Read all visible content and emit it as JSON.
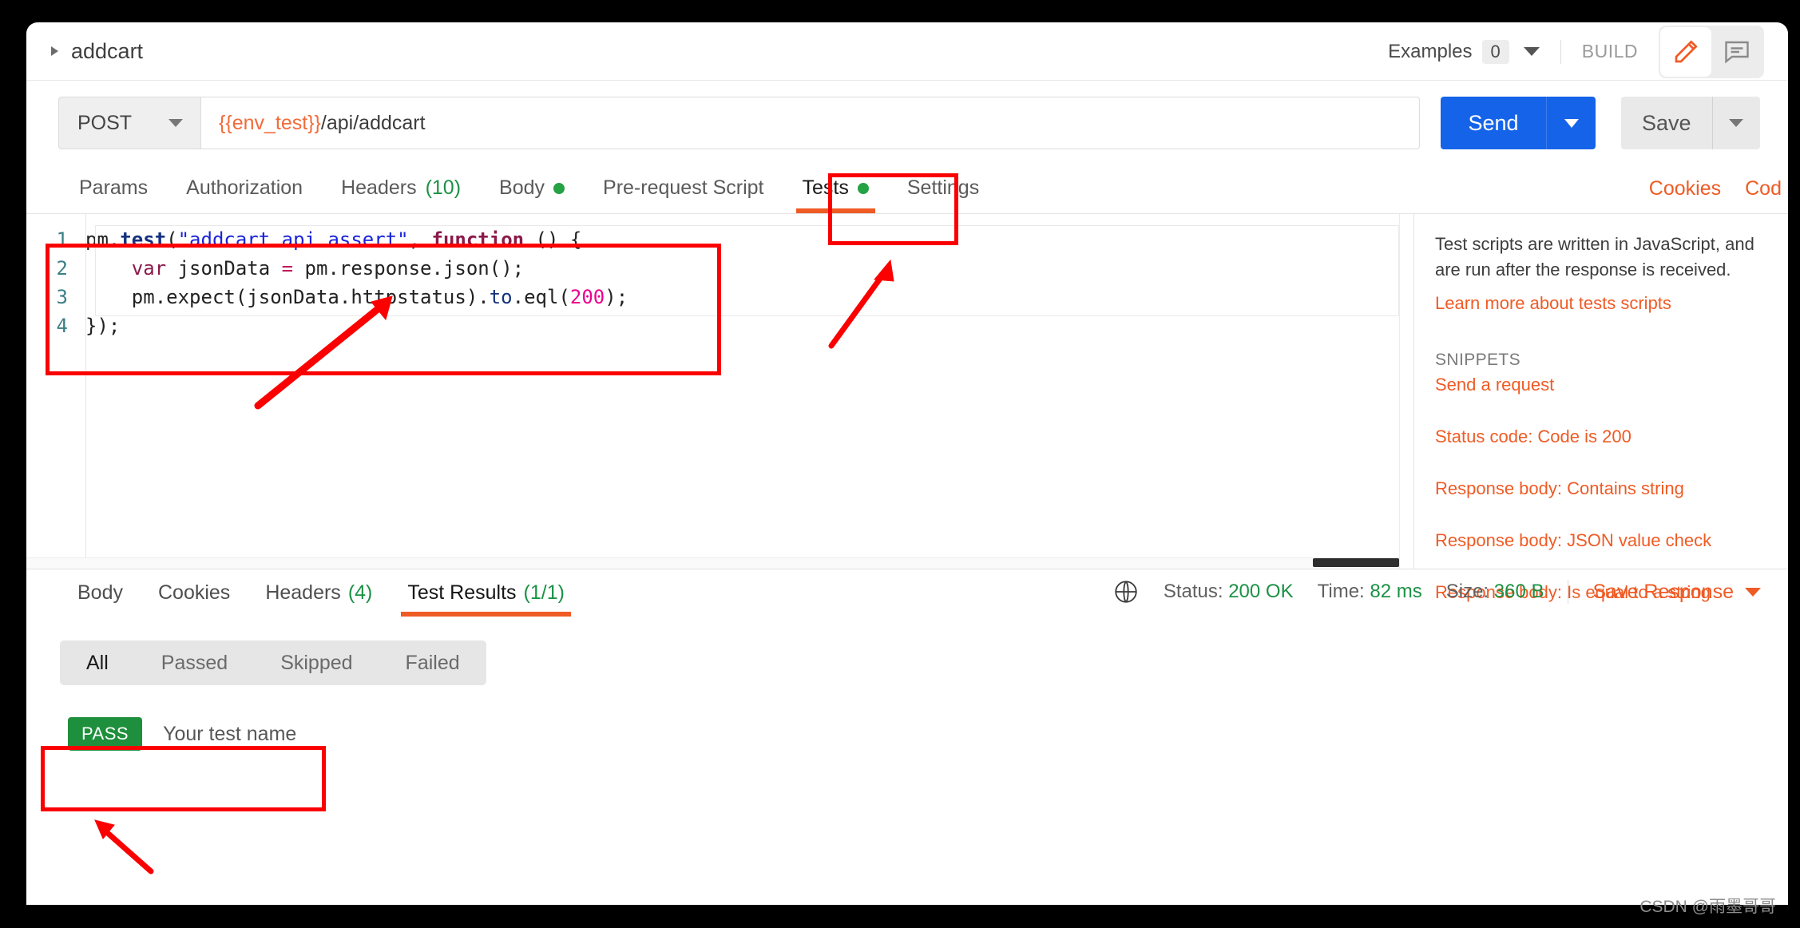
{
  "header": {
    "request_name": "addcart",
    "collapse_icon": "triangle-right-icon",
    "examples_label": "Examples",
    "examples_count": "0",
    "examples_caret": "chevron-down-icon",
    "build_label": "BUILD",
    "edit_icon": "pencil-icon",
    "comment_icon": "comment-icon"
  },
  "url_bar": {
    "method": "POST",
    "method_caret": "chevron-down-icon",
    "url_variable": "{{env_test}}",
    "url_path": "/api/addcart",
    "send_label": "Send",
    "send_caret": "chevron-down-icon",
    "save_label": "Save",
    "save_caret": "chevron-down-icon"
  },
  "request_tabs": [
    {
      "label": "Params",
      "count": "",
      "dot": false,
      "active": false
    },
    {
      "label": "Authorization",
      "count": "",
      "dot": false,
      "active": false
    },
    {
      "label": "Headers",
      "count": "(10)",
      "dot": false,
      "active": false
    },
    {
      "label": "Body",
      "count": "",
      "dot": true,
      "active": false
    },
    {
      "label": "Pre-request Script",
      "count": "",
      "dot": false,
      "active": false
    },
    {
      "label": "Tests",
      "count": "",
      "dot": true,
      "active": true
    },
    {
      "label": "Settings",
      "count": "",
      "dot": false,
      "active": false
    }
  ],
  "request_tab_links": [
    "Cookies",
    "Cod"
  ],
  "code": {
    "lines": [
      {
        "num": "1"
      },
      {
        "num": "2"
      },
      {
        "num": "3"
      },
      {
        "num": "4"
      }
    ],
    "line1_text": "pm.test(\"addcart api assert\", function () {",
    "line2_text": "    var jsonData = pm.response.json();",
    "line3_text": "    pm.expect(jsonData.httpstatus).to.eql(200);",
    "line4_text": "});",
    "t1_pm": "pm",
    "t1_dot": ".",
    "t1_test": "test",
    "t1_paren": "(",
    "t1_str": "\"addcart api assert\"",
    "t1_comma": ", ",
    "t1_function": "function",
    "t1_tail": " () {",
    "t2_indent": "    ",
    "t2_var": "var",
    "t2_name": " jsonData ",
    "t2_eq": "=",
    "t2_tail": " pm.response.json();",
    "t3_indent": "    ",
    "t3_head": "pm.expect(jsonData.httpstatus).",
    "t3_to": "to",
    "t3_mid": ".eql(",
    "t3_num": "200",
    "t3_tail": ");",
    "t4_text": "});"
  },
  "snippets": {
    "description": "Test scripts are written in JavaScript, and are run after the response is received.",
    "learn_more": "Learn more about tests scripts",
    "heading": "SNIPPETS",
    "items": [
      "Send a request",
      "Status code: Code is 200",
      "Response body: Contains string",
      "Response body: JSON value check",
      "Response body: Is equal to a string"
    ]
  },
  "response_tabs": [
    {
      "label": "Body",
      "count": "",
      "active": false
    },
    {
      "label": "Cookies",
      "count": "",
      "active": false
    },
    {
      "label": "Headers",
      "count": "(4)",
      "active": false
    },
    {
      "label": "Test Results",
      "count": "(1/1)",
      "active": true
    }
  ],
  "response_meta": {
    "globe_icon": "globe-icon",
    "status_label": "Status:",
    "status_value": "200 OK",
    "time_label": "Time:",
    "time_value": "82 ms",
    "size_label": "Size:",
    "size_value": "360 B",
    "save_response_label": "Save Response",
    "save_response_caret": "chevron-down-icon"
  },
  "result_filters": [
    {
      "label": "All",
      "active": true
    },
    {
      "label": "Passed",
      "active": false
    },
    {
      "label": "Skipped",
      "active": false
    },
    {
      "label": "Failed",
      "active": false
    }
  ],
  "test_result": {
    "status": "PASS",
    "name": "Your test name"
  },
  "watermark": "CSDN @雨墨哥哥",
  "colors": {
    "accent_orange": "#ef5b25",
    "send_blue": "#1563e8",
    "pass_green": "#1e8f3c",
    "annotation_red": "#fa0000"
  }
}
